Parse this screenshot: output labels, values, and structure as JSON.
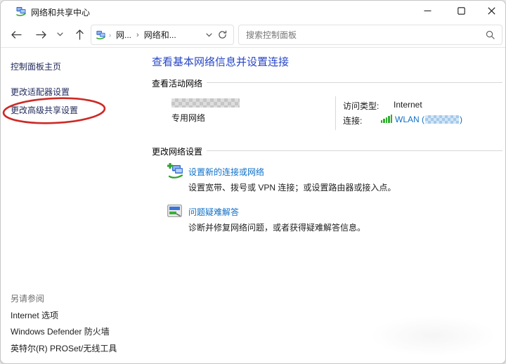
{
  "window": {
    "title": "网络和共享中心",
    "icon": "network-sharing-center-icon",
    "controls": {
      "minimize": "最小化",
      "maximize": "最大化",
      "close": "关闭"
    }
  },
  "navbar": {
    "breadcrumb_root": "网...",
    "breadcrumb_separator": "›",
    "breadcrumb_current": "网络和...",
    "search_placeholder": "搜索控制面板"
  },
  "sidebar": {
    "home": "控制面板主页",
    "adapter_settings": "更改适配器设置",
    "advanced_sharing": "更改高级共享设置",
    "advanced_sharing_annotated": true,
    "see_also_heading": "另请参阅",
    "see_also": {
      "internet_options": "Internet 选项",
      "defender_firewall": "Windows Defender 防火墙",
      "intel_proset": "英特尔(R) PROSet/无线工具"
    }
  },
  "main": {
    "heading": "查看基本网络信息并设置连接",
    "active_section_title": "查看活动网络",
    "network": {
      "name_obscured": true,
      "type": "专用网络",
      "access_type_label": "访问类型:",
      "access_type_value": "Internet",
      "connections_label": "连接:",
      "wlan_prefix": "WLAN (",
      "wlan_name_obscured": true,
      "wlan_suffix": ")"
    },
    "settings_section_title": "更改网络设置",
    "items": [
      {
        "title": "设置新的连接或网络",
        "desc": "设置宽带、拨号或 VPN 连接；或设置路由器或接入点。"
      },
      {
        "title": "问题疑难解答",
        "desc": "诊断并修复网络问题，或者获得疑难解答信息。"
      }
    ]
  },
  "colors": {
    "heading_blue": "#2746c6",
    "link_blue": "#0e70c8",
    "sidebar_navy": "#232c5e",
    "annotation_red": "#cc2a26",
    "wifi_green": "#2fae2f",
    "divider_gray": "#d8d8d8"
  }
}
